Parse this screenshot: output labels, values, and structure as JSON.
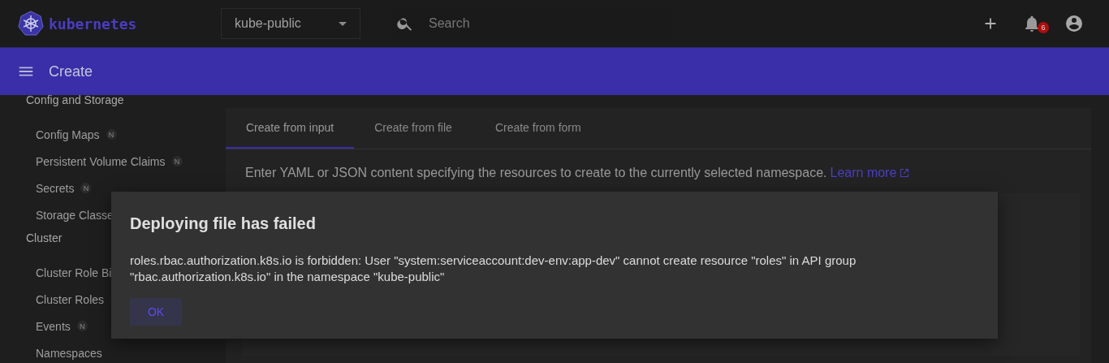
{
  "header": {
    "logo_text": "kubernetes",
    "namespace": {
      "value": "kube-public"
    },
    "search": {
      "placeholder": "Search"
    },
    "notifications": {
      "count": "6"
    }
  },
  "toolbar": {
    "title": "Create"
  },
  "sidebar": {
    "sections": [
      {
        "title": "Config and Storage",
        "items": [
          {
            "label": "Config Maps",
            "badge": "N"
          },
          {
            "label": "Persistent Volume Claims",
            "badge": "N"
          },
          {
            "label": "Secrets",
            "badge": "N"
          },
          {
            "label": "Storage Classe"
          }
        ]
      },
      {
        "title": "Cluster",
        "items": [
          {
            "label": "Cluster Role Bi"
          },
          {
            "label": "Cluster Roles"
          },
          {
            "label": "Events",
            "badge": "N"
          },
          {
            "label": "Namespaces"
          }
        ]
      }
    ]
  },
  "tabs": [
    {
      "label": "Create from input",
      "selected": true
    },
    {
      "label": "Create from file",
      "selected": false
    },
    {
      "label": "Create from form",
      "selected": false
    }
  ],
  "description": {
    "text": "Enter YAML or JSON content specifying the resources to create to the currently selected namespace.",
    "link": "Learn more"
  },
  "dialog": {
    "title": "Deploying file has failed",
    "message": "roles.rbac.authorization.k8s.io is forbidden: User \"system:serviceaccount:dev-env:app-dev\" cannot create resource \"roles\" in API group \"rbac.authorization.k8s.io\" in the namespace \"kube-public\"",
    "buttons": [
      "OK"
    ]
  }
}
